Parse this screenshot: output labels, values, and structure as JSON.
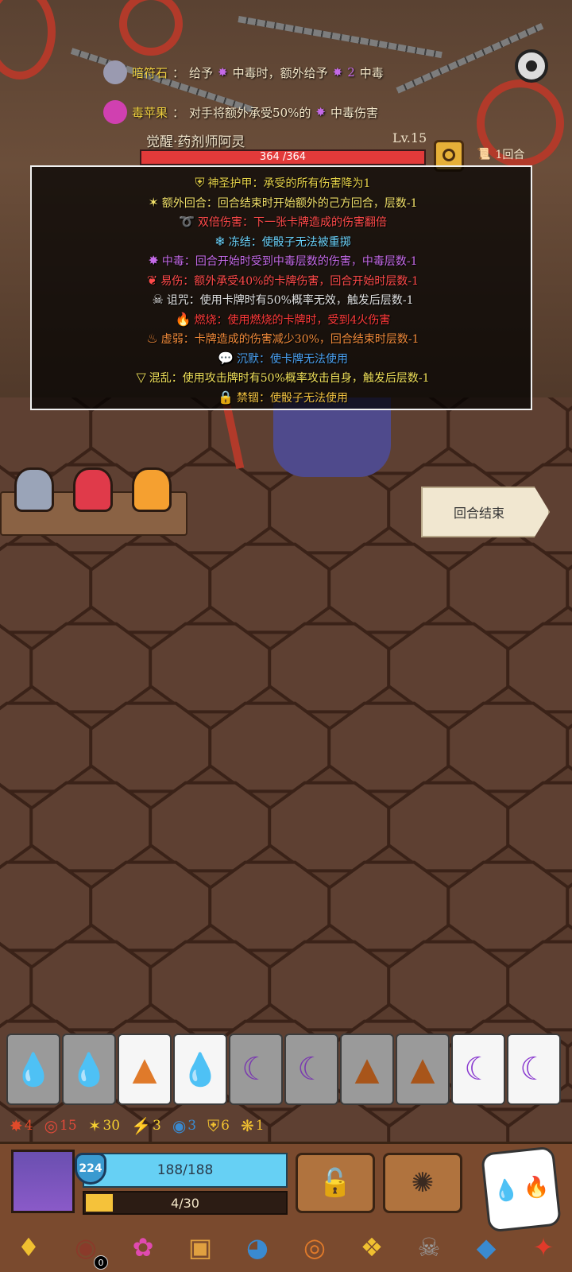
{
  "relics_top": [
    {
      "name": "暗符石",
      "desc": "给予",
      "extra": "中毒时，额外给予",
      "count": "2",
      "suffix": "中毒"
    },
    {
      "name": "毒苹果",
      "desc": "对手将额外承受50%的",
      "suffix": "中毒伤害"
    }
  ],
  "enemy": {
    "name": "觉醒·药剂师阿灵",
    "level": "Lv.15",
    "hp": "364 /364"
  },
  "turn": {
    "label": "1回合"
  },
  "tooltip_lines": [
    {
      "icon": "holy-armor-icon",
      "glyph": "⛨",
      "color": "#e8d44a",
      "text": "神圣护甲：承受的所有伤害降为1"
    },
    {
      "icon": "extra-turn-icon",
      "glyph": "✶",
      "color": "#f1e06a",
      "text": "额外回合：回合结束时开始额外的己方回合，层数-1"
    },
    {
      "icon": "double-damage-icon",
      "glyph": "➰",
      "color": "#ff4a4a",
      "text": "双倍伤害：下一张卡牌造成的伤害翻倍"
    },
    {
      "icon": "freeze-icon",
      "glyph": "❄",
      "color": "#6ad0f8",
      "text": "冻结：使骰子无法被重掷"
    },
    {
      "icon": "poison-icon",
      "glyph": "✸",
      "color": "#c56ae8",
      "text": "中毒：回合开始时受到中毒层数的伤害，中毒层数-1"
    },
    {
      "icon": "vulnerable-icon",
      "glyph": "❦",
      "color": "#ff4a4a",
      "text": "易伤：额外承受40%的卡牌伤害，回合开始时层数-1"
    },
    {
      "icon": "curse-icon",
      "glyph": "☠",
      "color": "#e0e0e0",
      "text": "诅咒：使用卡牌时有50%概率无效，触发后层数-1"
    },
    {
      "icon": "burn-icon",
      "glyph": "🔥",
      "color": "#ff3a3a",
      "text": "燃烧：使用燃烧的卡牌时，受到4火伤害"
    },
    {
      "icon": "weak-icon",
      "glyph": "♨",
      "color": "#f08a3a",
      "text": "虚弱：卡牌造成的伤害减少30%，回合结束时层数-1"
    },
    {
      "icon": "silence-icon",
      "glyph": "💬",
      "color": "#4aa0f0",
      "text": "沉默：使卡牌无法使用"
    },
    {
      "icon": "confusion-icon",
      "glyph": "▽",
      "color": "#f0e05a",
      "text": "混乱：使用攻击牌时有50%概率攻击自身，触发后层数-1"
    },
    {
      "icon": "lock-icon",
      "glyph": "🔒",
      "color": "#f0c040",
      "text": "禁锢：使骰子无法使用"
    }
  ],
  "end_turn": {
    "label": "回合结束"
  },
  "dice": [
    {
      "icon": "water-drop-icon",
      "glyph": "💧",
      "active": false,
      "color": "#1a5aa8"
    },
    {
      "icon": "water-drop-icon",
      "glyph": "💧",
      "active": false,
      "color": "#1a5aa8"
    },
    {
      "icon": "earth-icon",
      "glyph": "▲",
      "active": true,
      "color": "#e07a2a"
    },
    {
      "icon": "water-drop-icon",
      "glyph": "💧",
      "active": true,
      "color": "#2a7ae0"
    },
    {
      "icon": "moon-icon",
      "glyph": "☾",
      "active": false,
      "color": "#7a3ab0"
    },
    {
      "icon": "moon-icon",
      "glyph": "☾",
      "active": false,
      "color": "#7a3ab0"
    },
    {
      "icon": "earth-icon",
      "glyph": "▲",
      "active": false,
      "color": "#a8551a"
    },
    {
      "icon": "earth-icon",
      "glyph": "▲",
      "active": false,
      "color": "#a8551a"
    },
    {
      "icon": "moon-icon",
      "glyph": "☾",
      "active": true,
      "color": "#8a3ad0"
    },
    {
      "icon": "moon-icon",
      "glyph": "☾",
      "active": true,
      "color": "#8a3ad0"
    }
  ],
  "statuses": [
    {
      "icon": "poison-stack-icon",
      "glyph": "✸",
      "value": "4",
      "color": "#e04a2a"
    },
    {
      "icon": "swirl-icon",
      "glyph": "◎",
      "value": "15",
      "color": "#e04a3a"
    },
    {
      "icon": "spark-icon",
      "glyph": "✶",
      "value": "30",
      "color": "#f5d030"
    },
    {
      "icon": "lightning-icon",
      "glyph": "⚡",
      "value": "3",
      "color": "#f5d030"
    },
    {
      "icon": "water-ring-icon",
      "glyph": "◉",
      "value": "3",
      "color": "#3a8ad0"
    },
    {
      "icon": "shield-ring-icon",
      "glyph": "⛨",
      "value": "6",
      "color": "#f0c030"
    },
    {
      "icon": "wing-icon",
      "glyph": "❋",
      "value": "1",
      "color": "#f0c030"
    }
  ],
  "player": {
    "armor": "224",
    "hp": "188/188",
    "energy": "4/30",
    "energy_fraction": 0.133
  },
  "relics_bottom": [
    {
      "icon": "amulet-icon",
      "glyph": "♦",
      "color": "#f0c030"
    },
    {
      "icon": "button-icon",
      "glyph": "◉",
      "color": "#8a3a2a",
      "badge": "0"
    },
    {
      "icon": "pink-blob-icon",
      "glyph": "✿",
      "color": "#e04ab0"
    },
    {
      "icon": "dice-cube-icon",
      "glyph": "▣",
      "color": "#e0a040"
    },
    {
      "icon": "blue-shell-icon",
      "glyph": "◕",
      "color": "#3a8ad0"
    },
    {
      "icon": "orange-shield-icon",
      "glyph": "◎",
      "color": "#e07a2a"
    },
    {
      "icon": "yellow-frame-icon",
      "glyph": "❖",
      "color": "#f0c030"
    },
    {
      "icon": "skull-helmet-icon",
      "glyph": "☠",
      "color": "#9a9a9a"
    },
    {
      "icon": "blue-crystal-icon",
      "glyph": "◆",
      "color": "#3a8ad0"
    },
    {
      "icon": "red-dragon-icon",
      "glyph": "✦",
      "color": "#e03a2a"
    }
  ]
}
